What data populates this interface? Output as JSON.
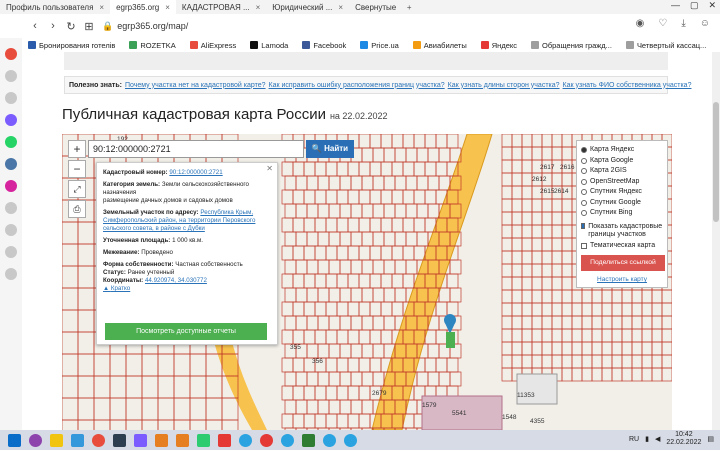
{
  "browser": {
    "tabs": [
      {
        "label": "Профиль пользователя",
        "active": false
      },
      {
        "label": "egrp365.org",
        "active": true
      },
      {
        "label": "КАДАСТРОВАЯ ...",
        "active": false
      },
      {
        "label": "Юридический ...",
        "active": false
      },
      {
        "label": "Свернутые",
        "active": false
      }
    ],
    "url": "egrp365.org/map/"
  },
  "bookmarks": [
    {
      "label": "Бронирования готелів",
      "color": "#2a5cab"
    },
    {
      "label": "ROZETKA",
      "color": "#3aa157"
    },
    {
      "label": "AliExpress",
      "color": "#e84c3d"
    },
    {
      "label": "Lamoda",
      "color": "#111111"
    },
    {
      "label": "Facebook",
      "color": "#3b5998"
    },
    {
      "label": "Price.ua",
      "color": "#1e88e5"
    },
    {
      "label": "Авиабилеты",
      "color": "#f39c12"
    },
    {
      "label": "Яндекс",
      "color": "#e53935"
    },
    {
      "label": "Обращения гражд...",
      "color": "#9e9e9e"
    },
    {
      "label": "Четвертый кассац...",
      "color": "#9e9e9e"
    }
  ],
  "tips": {
    "prefix": "Полезно знать:",
    "links": [
      "Почему участка нет на кадастровой карте?",
      "Как исправить ошибку расположения границ участка?",
      "Как узнать длины сторон участка?",
      "Как узнать ФИО собственника участка?"
    ]
  },
  "page": {
    "title": "Публичная кадастровая карта России",
    "date": "на 22.02.2022"
  },
  "map": {
    "search_value": "90:12:000000:2721",
    "find_label": "Найти",
    "zoom_in": "+",
    "zoom_out": "−"
  },
  "info": {
    "cad_label": "Кадастровый номер:",
    "cad_value": "90:12:000000:2721",
    "cat_label": "Категория земель:",
    "cat_value": "Земли сельскохозяйственного назначения",
    "use_value": "размещение дачных домов и садовых домов",
    "addr_label": "Земельный участок по адресу:",
    "addr_value": "Республика Крым, Симферопольский район, на территории Перовского сельского совета, в районе с Дубки",
    "area_label": "Уточненная площадь:",
    "area_value": "1 000 кв.м.",
    "survey_label": "Межевание:",
    "survey_value": "Проведено",
    "own_label": "Форма собственности:",
    "own_value": "Частная собственность",
    "status_label": "Статус:",
    "status_value": "Ранее учтенный",
    "coord_label": "Координаты:",
    "coord_value": "44.920974, 34.030772",
    "brief_link": "Кратко",
    "reports_button": "Посмотреть доступные отчеты"
  },
  "layers": {
    "options": [
      {
        "label": "Карта Яндекс",
        "checked": true
      },
      {
        "label": "Карта Google",
        "checked": false
      },
      {
        "label": "Карта 2GIS",
        "checked": false
      },
      {
        "label": "OpenStreetMap",
        "checked": false
      },
      {
        "label": "Спутник Яндекс",
        "checked": false
      },
      {
        "label": "Спутник Google",
        "checked": false
      },
      {
        "label": "Спутник Bing",
        "checked": false
      }
    ],
    "cadastral_borders": "Показать кадастровые границы участков",
    "thematic": "Тематическая карта",
    "share_button": "Поделиться ссылкой",
    "setup_link": "Настроить карту"
  },
  "parcel_numbers": [
    "192",
    "2617",
    "2612",
    "2615",
    "2616",
    "2614",
    "355",
    "356",
    "2679",
    "2796",
    "1579",
    "11353",
    "5541",
    "1548",
    "4355"
  ],
  "taskbar": {
    "lang": "RU",
    "time": "10:42",
    "date": "22.02.2022"
  }
}
